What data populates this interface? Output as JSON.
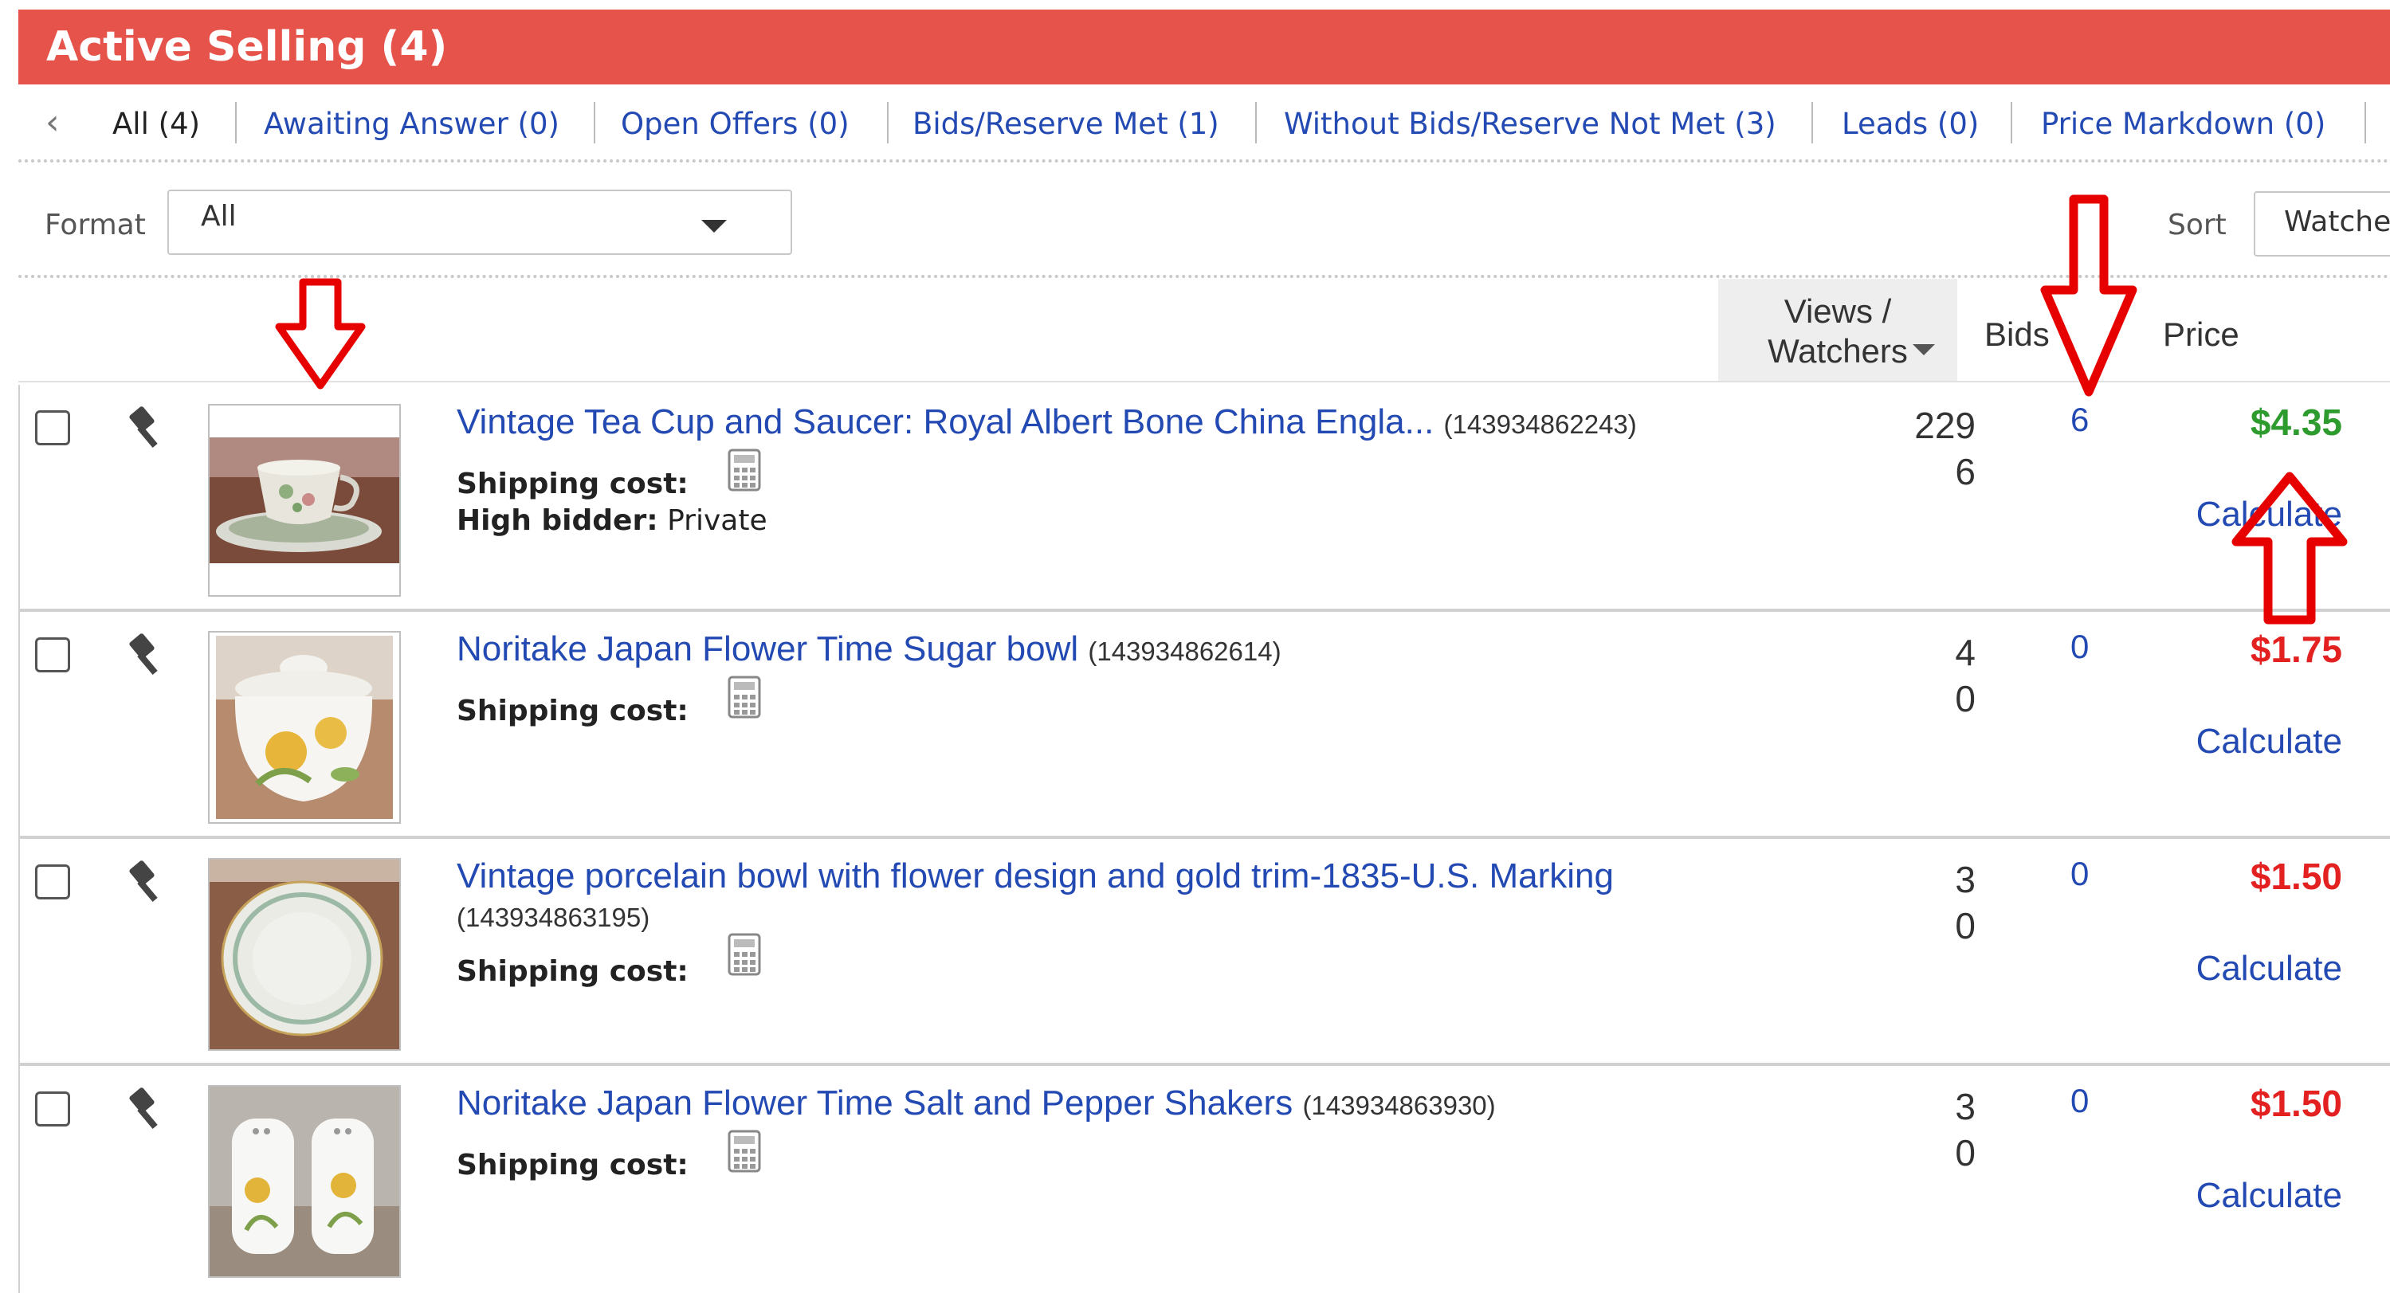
{
  "header": {
    "title": "Active Selling (4)"
  },
  "filters": {
    "items": [
      {
        "label": "All (4)"
      },
      {
        "label": "Awaiting Answer (0)"
      },
      {
        "label": "Open Offers (0)"
      },
      {
        "label": "Bids/Reserve Met (1)"
      },
      {
        "label": "Without Bids/Reserve Not Met (3)"
      },
      {
        "label": "Leads (0)"
      },
      {
        "label": "Price Markdown (0)"
      }
    ]
  },
  "toolbar": {
    "format_label": "Format",
    "format_value": "All",
    "sort_label": "Sort",
    "sort_value": "Watchers"
  },
  "table": {
    "headers": {
      "views": "Views /",
      "watchers": "Watchers",
      "bids": "Bids",
      "price": "Price"
    },
    "rows": [
      {
        "title": "Vintage Tea Cup and Saucer: Royal Albert Bone China Engla...",
        "id": "(143934862243)",
        "shipping": "Shipping cost:",
        "bidder_label": "High bidder:",
        "bidder_value": "Private",
        "views": "229",
        "watchers": "6",
        "bids": "6",
        "price": "$4.35",
        "calculate": "Calculate"
      },
      {
        "title": "Noritake Japan Flower Time Sugar bowl",
        "id": "(143934862614)",
        "shipping": "Shipping cost:",
        "views": "4",
        "watchers": "0",
        "bids": "0",
        "price": "$1.75",
        "calculate": "Calculate"
      },
      {
        "title": "Vintage porcelain bowl with flower design and gold trim-1835-U.S. Marking",
        "id": "(143934863195)",
        "shipping": "Shipping cost:",
        "views": "3",
        "watchers": "0",
        "bids": "0",
        "price": "$1.50",
        "calculate": "Calculate"
      },
      {
        "title": "Noritake Japan Flower Time Salt and Pepper Shakers",
        "id": "(143934863930)",
        "shipping": "Shipping cost:",
        "views": "3",
        "watchers": "0",
        "bids": "0",
        "price": "$1.50",
        "calculate": "Calculate"
      }
    ]
  },
  "colors": {
    "header_bg": "#e5534b",
    "link": "#2349b3",
    "price_green": "#2e9b2e",
    "price_red": "#e32121",
    "annotation_red": "#e60000"
  }
}
